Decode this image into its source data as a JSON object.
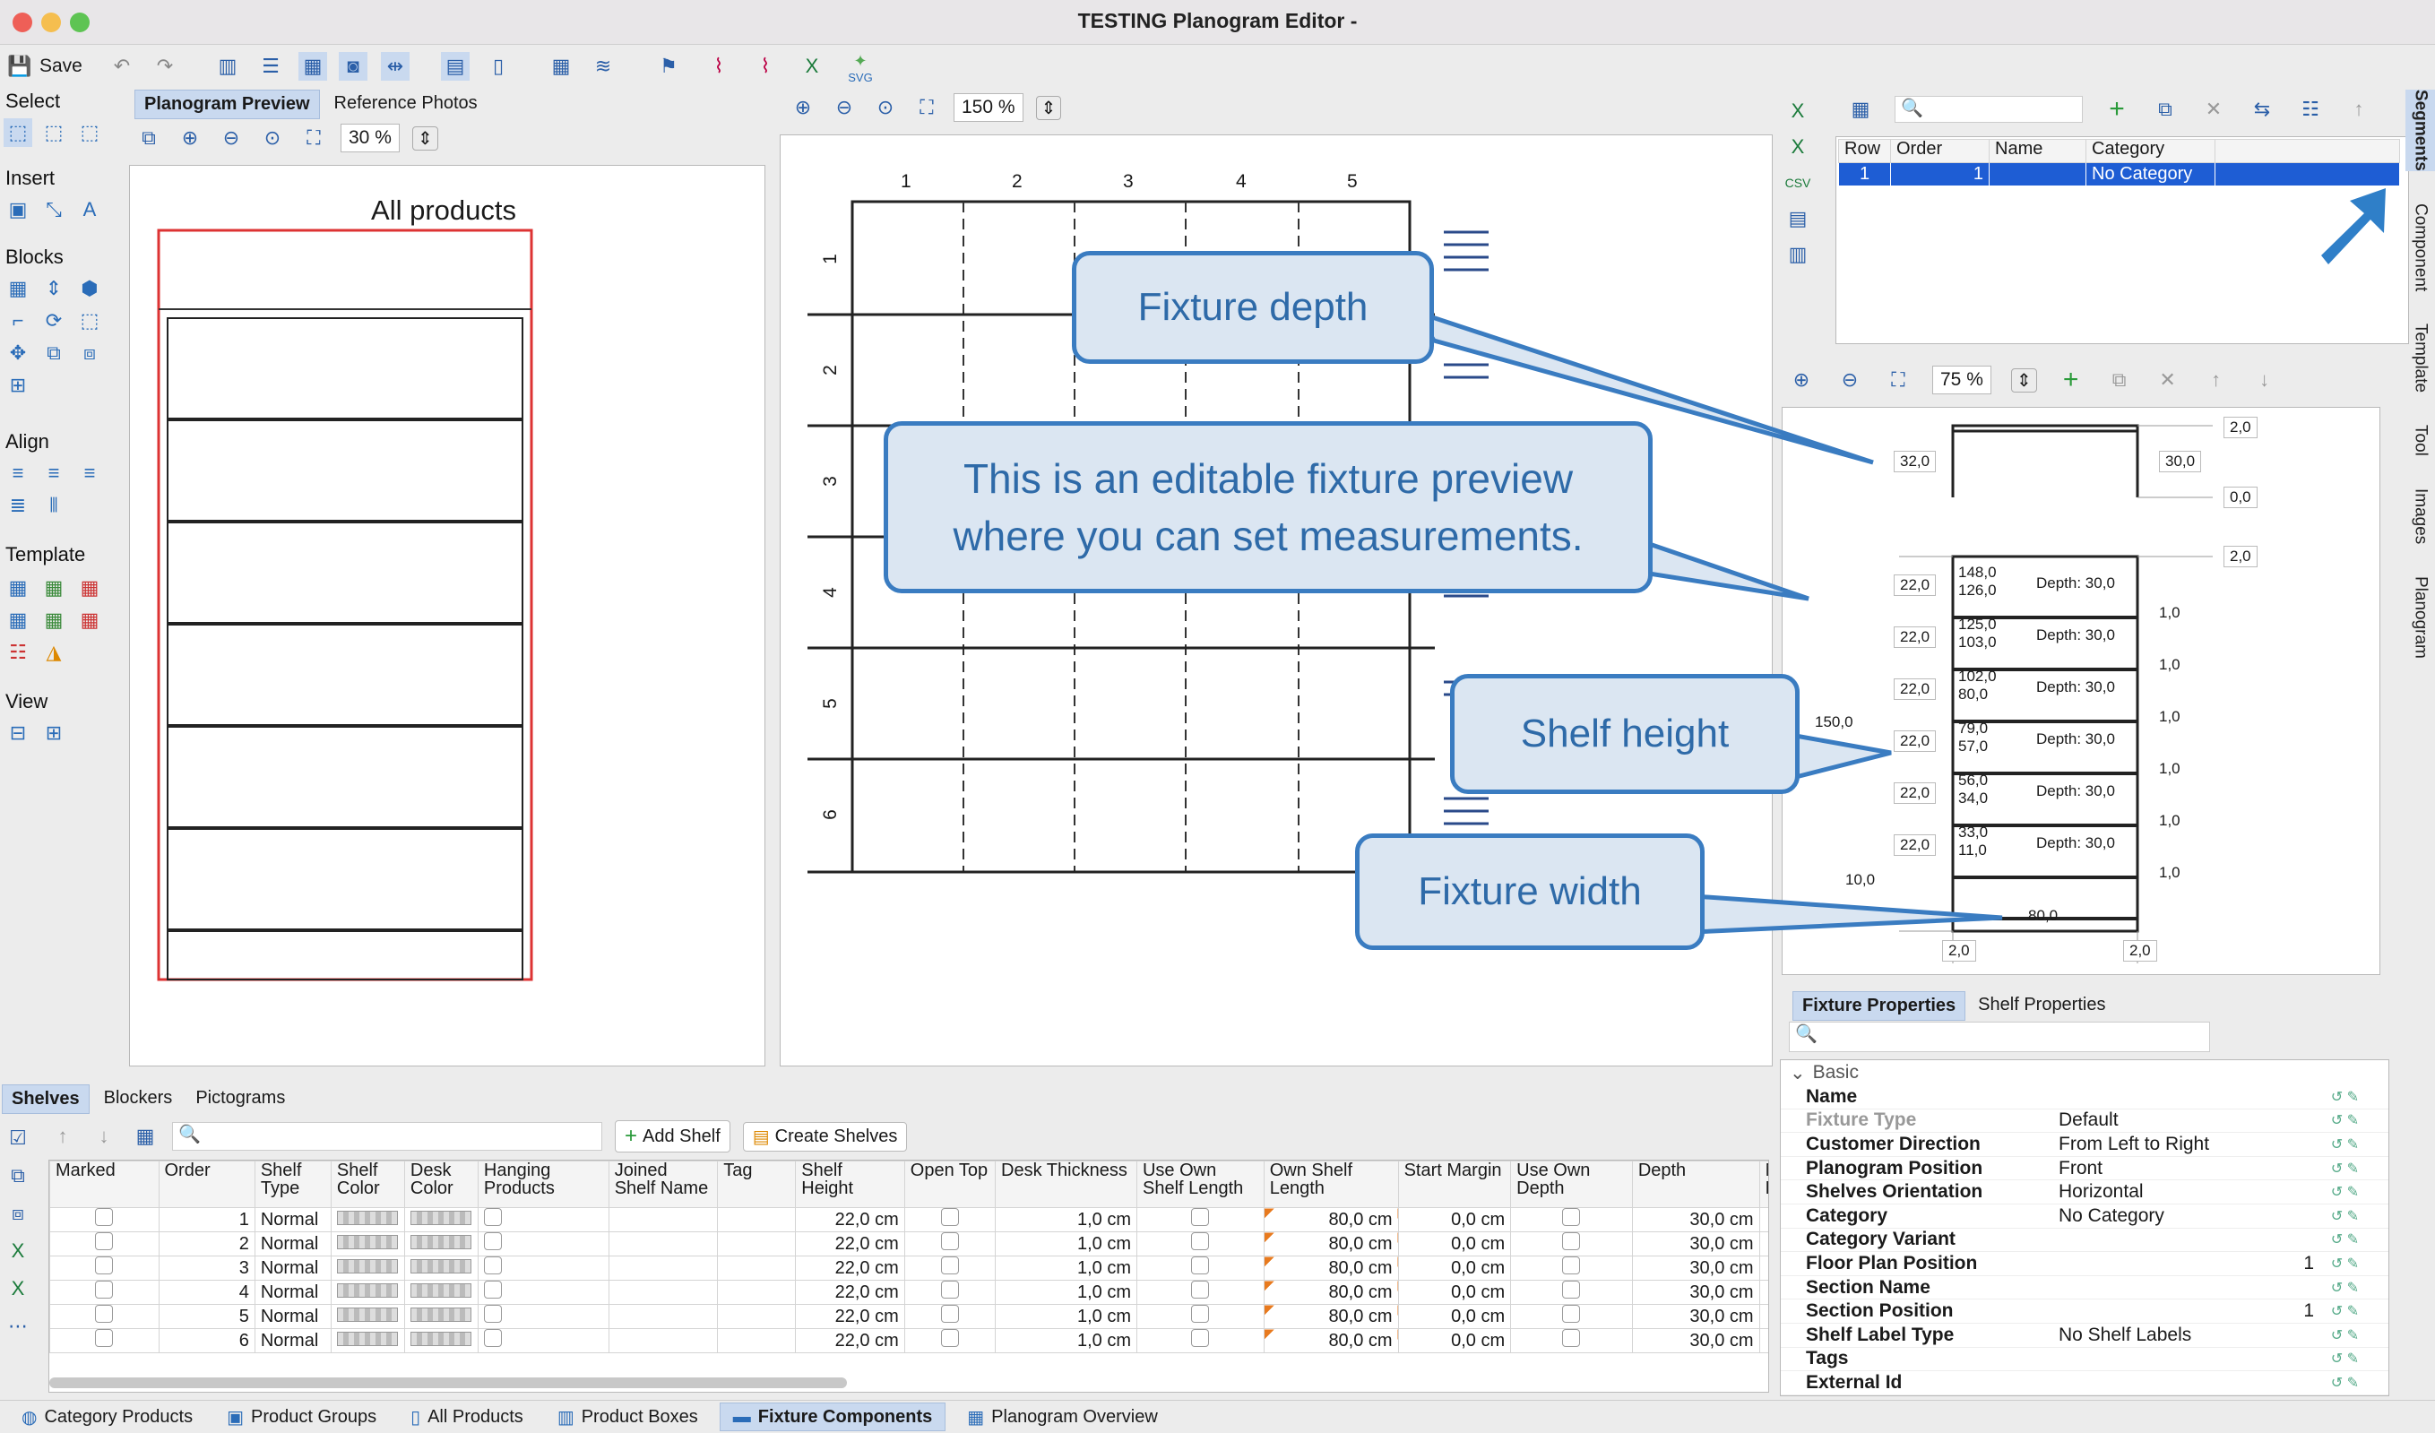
{
  "window": {
    "title": "TESTING Planogram Editor -"
  },
  "toolbar": {
    "save_label": "Save",
    "svg_label": "SVG"
  },
  "palette": {
    "select": "Select",
    "insert": "Insert",
    "blocks": "Blocks",
    "align": "Align",
    "template": "Template",
    "view": "View"
  },
  "preview": {
    "tab_preview": "Planogram Preview",
    "tab_photos": "Reference Photos",
    "zoom": "30 %",
    "title": "All products"
  },
  "fixture": {
    "zoom": "150 %",
    "columns": [
      "1",
      "2",
      "3",
      "4",
      "5"
    ],
    "rows": [
      "1",
      "2",
      "3",
      "4",
      "5",
      "6"
    ]
  },
  "callouts": {
    "depth": "Fixture depth",
    "editable_line1": "This is an editable fixture preview",
    "editable_line2": "where you can set measurements.",
    "shelf_height": "Shelf height",
    "width": "Fixture width"
  },
  "segments": {
    "headers": [
      "Row",
      "Order",
      "Name",
      "Category"
    ],
    "row": {
      "row": "1",
      "order": "1",
      "name": "",
      "category": "No Category"
    }
  },
  "fixture_preview": {
    "zoom": "75 %",
    "top_dims": {
      "depth": "32,0",
      "right_top": "2,0",
      "right_mid": "30,0",
      "right_bottom": "0,0"
    },
    "top2": "2,0",
    "total_height": "150,0",
    "shelves": [
      {
        "left": "22,0",
        "top": "148,0",
        "bottom": "126,0",
        "depth": "Depth: 30,0",
        "gap": "1,0"
      },
      {
        "left": "22,0",
        "top": "125,0",
        "bottom": "103,0",
        "depth": "Depth: 30,0",
        "gap": "1,0"
      },
      {
        "left": "22,0",
        "top": "102,0",
        "bottom": "80,0",
        "depth": "Depth: 30,0",
        "gap": "1,0"
      },
      {
        "left": "22,0",
        "top": "79,0",
        "bottom": "57,0",
        "depth": "Depth: 30,0",
        "gap": "1,0"
      },
      {
        "left": "22,0",
        "top": "56,0",
        "bottom": "34,0",
        "depth": "Depth: 30,0",
        "gap": "1,0"
      },
      {
        "left": "22,0",
        "top": "33,0",
        "bottom": "11,0",
        "depth": "Depth: 30,0",
        "gap": "1,0"
      }
    ],
    "base": "10,0",
    "width": "80,0",
    "side_left": "2,0",
    "side_right": "2,0"
  },
  "side_tabs": [
    "Segments",
    "Component",
    "Template",
    "Tool",
    "Images",
    "Planogram"
  ],
  "properties": {
    "tab_fixture": "Fixture Properties",
    "tab_shelf": "Shelf Properties",
    "group": "Basic",
    "rows": [
      {
        "key": "Name",
        "value": "",
        "num": "",
        "disabled": false
      },
      {
        "key": "Fixture Type",
        "value": "Default",
        "num": "",
        "disabled": true
      },
      {
        "key": "Customer Direction",
        "value": "From Left to Right",
        "num": "",
        "disabled": false
      },
      {
        "key": "Planogram Position",
        "value": "Front",
        "num": "",
        "disabled": false
      },
      {
        "key": "Shelves Orientation",
        "value": "Horizontal",
        "num": "",
        "disabled": false
      },
      {
        "key": "Category",
        "value": "No Category",
        "num": "",
        "disabled": false
      },
      {
        "key": "Category Variant",
        "value": "",
        "num": "",
        "disabled": false
      },
      {
        "key": "Floor Plan Position",
        "value": "",
        "num": "1",
        "disabled": false
      },
      {
        "key": "Section Name",
        "value": "",
        "num": "",
        "disabled": false
      },
      {
        "key": "Section Position",
        "value": "",
        "num": "1",
        "disabled": false
      },
      {
        "key": "Shelf Label Type",
        "value": "No Shelf Labels",
        "num": "",
        "disabled": false
      },
      {
        "key": "Tags",
        "value": "",
        "num": "",
        "disabled": false
      },
      {
        "key": "External Id",
        "value": "",
        "num": "",
        "disabled": false
      }
    ]
  },
  "shelves_panel": {
    "tabs": [
      "Shelves",
      "Blockers",
      "Pictograms"
    ],
    "add_shelf": "Add Shelf",
    "create_shelves": "Create Shelves",
    "headers": [
      "Marked",
      "Order",
      "Shelf Type",
      "Shelf Color",
      "Desk Color",
      "Hanging Products",
      "Joined Shelf Name",
      "Tag",
      "Shelf Height",
      "Open Top",
      "Desk Thickness",
      "Use Own Shelf Length",
      "Own Shelf Length",
      "Start Margin",
      "Use Own Depth",
      "Depth",
      "Ma Ho"
    ],
    "rows": [
      {
        "order": "1",
        "type": "Normal",
        "height": "22,0 cm",
        "thickness": "1,0 cm",
        "length": "80,0 cm",
        "margin": "0,0 cm",
        "depth": "30,0 cm"
      },
      {
        "order": "2",
        "type": "Normal",
        "height": "22,0 cm",
        "thickness": "1,0 cm",
        "length": "80,0 cm",
        "margin": "0,0 cm",
        "depth": "30,0 cm"
      },
      {
        "order": "3",
        "type": "Normal",
        "height": "22,0 cm",
        "thickness": "1,0 cm",
        "length": "80,0 cm",
        "margin": "0,0 cm",
        "depth": "30,0 cm"
      },
      {
        "order": "4",
        "type": "Normal",
        "height": "22,0 cm",
        "thickness": "1,0 cm",
        "length": "80,0 cm",
        "margin": "0,0 cm",
        "depth": "30,0 cm"
      },
      {
        "order": "5",
        "type": "Normal",
        "height": "22,0 cm",
        "thickness": "1,0 cm",
        "length": "80,0 cm",
        "margin": "0,0 cm",
        "depth": "30,0 cm"
      },
      {
        "order": "6",
        "type": "Normal",
        "height": "22,0 cm",
        "thickness": "1,0 cm",
        "length": "80,0 cm",
        "margin": "0,0 cm",
        "depth": "30,0 cm"
      }
    ]
  },
  "bottom_tabs": [
    "Category Products",
    "Product Groups",
    "All Products",
    "Product Boxes",
    "Fixture Components",
    "Planogram Overview"
  ]
}
